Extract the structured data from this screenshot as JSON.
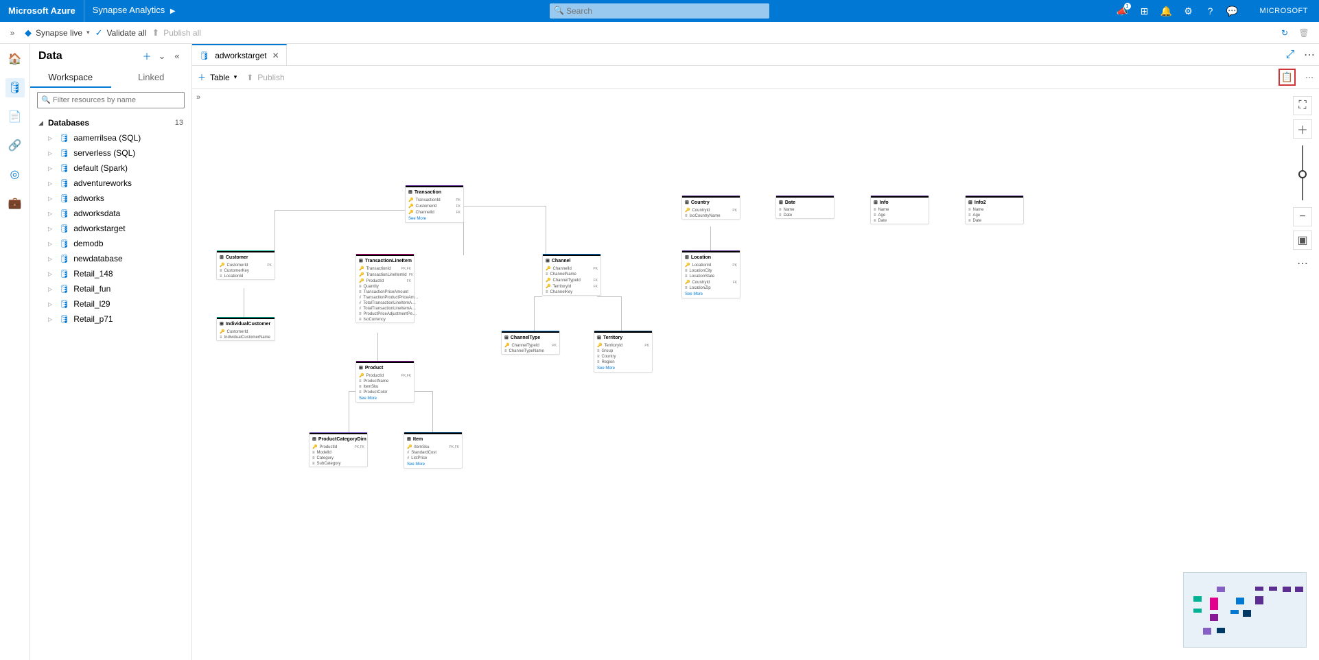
{
  "header": {
    "brand": "Microsoft Azure",
    "product": "Synapse Analytics",
    "search_placeholder": "Search",
    "notif_count": "1",
    "account": "MICROSOFT"
  },
  "cmd": {
    "live": "Synapse live",
    "validate": "Validate all",
    "publish": "Publish all"
  },
  "side": {
    "title": "Data",
    "tab_workspace": "Workspace",
    "tab_linked": "Linked",
    "filter_placeholder": "Filter resources by name",
    "group_label": "Databases",
    "group_count": "13",
    "items": [
      "aamerrilsea (SQL)",
      "serverless (SQL)",
      "default (Spark)",
      "adventureworks",
      "adworks",
      "adworksdata",
      "adworkstarget",
      "demodb",
      "newdatabase",
      "Retail_148",
      "Retail_fun",
      "Retail_l29",
      "Retail_p71"
    ]
  },
  "filetab": {
    "name": "adworkstarget"
  },
  "toolbar": {
    "table": "Table",
    "publish": "Publish"
  },
  "entities": {
    "transaction": {
      "title": "Transaction",
      "r": [
        "TransactionId",
        "CustomerId",
        "ChannelId"
      ],
      "k": [
        "PK",
        "FK",
        "FK"
      ],
      "color": "c-purple"
    },
    "customer": {
      "title": "Customer",
      "r": [
        "CustomerId",
        "CustomerKey",
        "LocationId"
      ],
      "k": [
        "PK",
        "",
        ""
      ],
      "color": "c-teal"
    },
    "individualcustomer": {
      "title": "IndividualCustomer",
      "r": [
        "CustomerId",
        "IndividualCustomerName"
      ],
      "k": [
        "",
        ""
      ],
      "color": "c-teal"
    },
    "transactionlineitem": {
      "title": "TransactionLineItem",
      "r": [
        "TransactionId",
        "TransactionLineItemId",
        "ProductId",
        "Quantity",
        "TransactionPriceAmount",
        "TransactionProductPriceAm…",
        "TotalTransactionLineItemA…",
        "TotalTransactionLineItemA…",
        "ProductPriceAdjustmentPe…",
        "IsoCurrency"
      ],
      "k": [
        "PK,FK",
        "PK",
        "FK",
        "",
        "",
        "",
        "",
        "",
        "",
        ""
      ],
      "color": "c-pink"
    },
    "channel": {
      "title": "Channel",
      "r": [
        "ChannelId",
        "ChannelName",
        "ChannelTypeId",
        "TerritoryId",
        "ChannelKey"
      ],
      "k": [
        "PK",
        "",
        "FK",
        "FK",
        ""
      ],
      "color": "c-blue"
    },
    "channeltype": {
      "title": "ChannelType",
      "r": [
        "ChannelTypeId",
        "ChannelTypeName"
      ],
      "k": [
        "PK",
        ""
      ],
      "color": "c-blue"
    },
    "territory": {
      "title": "Territory",
      "r": [
        "TerritoryId",
        "Group",
        "Country",
        "Region"
      ],
      "k": [
        "PK",
        "",
        "",
        ""
      ],
      "color": "c-navy"
    },
    "product": {
      "title": "Product",
      "r": [
        "ProductId",
        "ProductName",
        "ItemSku",
        "ProductColor"
      ],
      "k": [
        "PK,FK",
        "",
        "",
        ""
      ],
      "color": "c-dpurple"
    },
    "productcategory": {
      "title": "ProductCategoryDim",
      "r": [
        "ProductId",
        "ModelId",
        "Category",
        "SubCategory"
      ],
      "k": [
        "PK,FK",
        "",
        "",
        ""
      ],
      "color": "c-lpurple"
    },
    "item": {
      "title": "Item",
      "r": [
        "ItemSku",
        "StandardCost",
        "ListPrice"
      ],
      "k": [
        "PK,FK",
        "",
        ""
      ],
      "color": "c-navy"
    },
    "country": {
      "title": "Country",
      "r": [
        "CountryId",
        "IsoCountryName"
      ],
      "k": [
        "PK",
        ""
      ],
      "color": "c-purple"
    },
    "date": {
      "title": "Date",
      "r": [
        "Name",
        "Date"
      ],
      "k": [
        "",
        ""
      ],
      "color": "c-purple"
    },
    "info": {
      "title": "Info",
      "r": [
        "Name",
        "Age",
        "Date"
      ],
      "k": [
        "",
        "",
        ""
      ],
      "color": "c-purple"
    },
    "info2": {
      "title": "Info2",
      "r": [
        "Name",
        "Age",
        "Date"
      ],
      "k": [
        "",
        "",
        ""
      ],
      "color": "c-purple"
    },
    "location": {
      "title": "Location",
      "r": [
        "LocationId",
        "LocationCity",
        "LocationState",
        "CountryId",
        "LocationZip"
      ],
      "k": [
        "PK",
        "",
        "",
        "FK",
        ""
      ],
      "color": "c-purple"
    }
  },
  "seemore": "See More"
}
